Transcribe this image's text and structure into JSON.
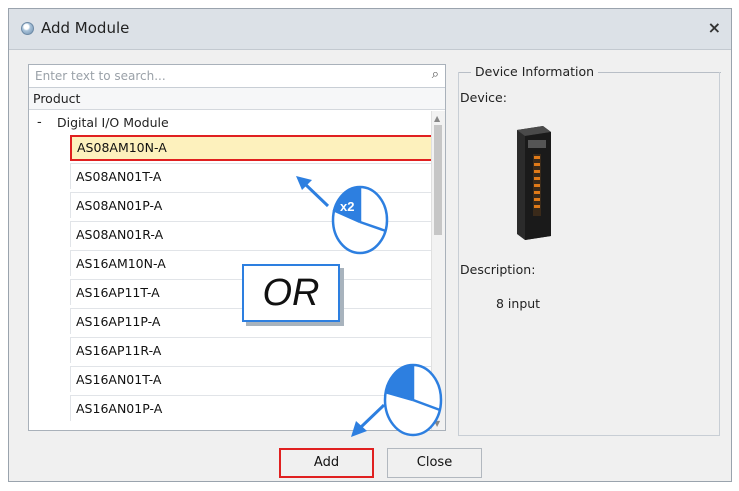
{
  "window": {
    "title": "Add Module",
    "close_glyph": "×"
  },
  "search": {
    "placeholder": "Enter text to search..."
  },
  "tree": {
    "column_header": "Product",
    "group": {
      "expander": "-",
      "label": "Digital I/O Module"
    },
    "items": [
      "AS08AM10N-A",
      "AS08AN01T-A",
      "AS08AN01P-A",
      "AS08AN01R-A",
      "AS16AM10N-A",
      "AS16AP11T-A",
      "AS16AP11P-A",
      "AS16AP11R-A",
      "AS16AN01T-A",
      "AS16AN01P-A"
    ],
    "selected_index": 0
  },
  "device_info": {
    "legend": "Device Information",
    "device_label": "Device:",
    "description_label": "Description:",
    "description_value": "8 input"
  },
  "buttons": {
    "add": "Add",
    "close": "Close"
  },
  "annotations": {
    "or_label": "OR",
    "double_click_badge": "x2",
    "highlight_color": "#e02020",
    "arrow_color": "#2d7fe0"
  }
}
